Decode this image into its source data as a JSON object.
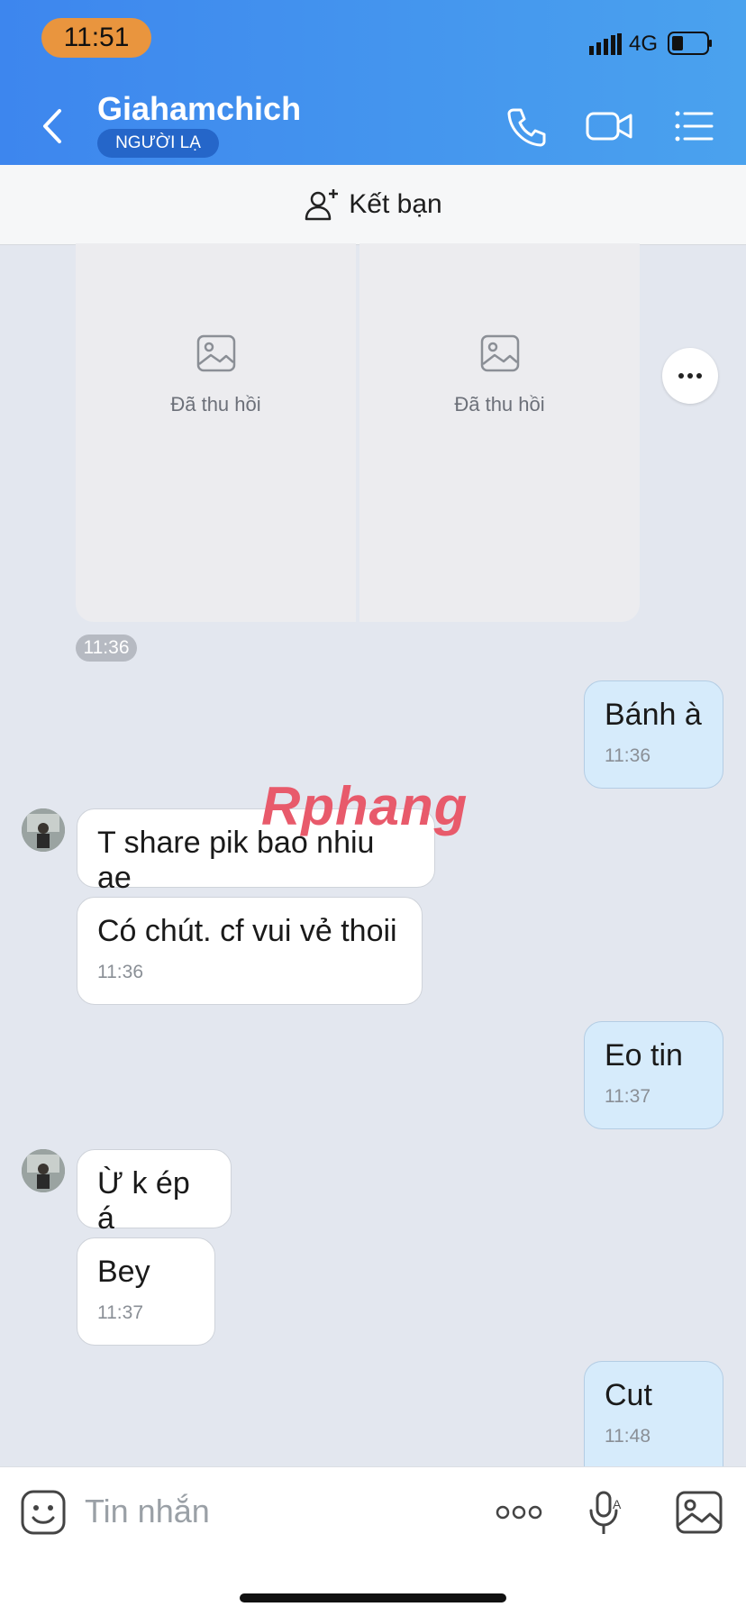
{
  "status_bar": {
    "time": "11:51",
    "network": "4G"
  },
  "header": {
    "title": "Giahamchich",
    "badge": "NGƯỜI LẠ"
  },
  "friend_bar": {
    "label": "Kết bạn"
  },
  "revoked_images": [
    {
      "label": "Đã thu hồi"
    },
    {
      "label": "Đã thu hồi"
    }
  ],
  "revoked_time": "11:36",
  "messages": [
    {
      "side": "out",
      "text": "Bánh à",
      "time": "11:36"
    },
    {
      "side": "in",
      "text": "T share pik bao nhiu ae",
      "time": ""
    },
    {
      "side": "in",
      "text": "Có chút. cf vui vẻ thoii",
      "time": "11:36"
    },
    {
      "side": "out",
      "text": "Eo tin",
      "time": "11:37"
    },
    {
      "side": "in",
      "text": "Ừ k ép á",
      "time": ""
    },
    {
      "side": "in",
      "text": "Bey",
      "time": "11:37"
    },
    {
      "side": "out",
      "text": "Cut",
      "time": "11:48"
    }
  ],
  "watermark": "Rphang",
  "composer": {
    "placeholder": "Tin nhắn"
  },
  "icons": [
    "back-icon",
    "phone-icon",
    "video-icon",
    "menu-icon",
    "add-friend-icon",
    "image-icon",
    "more-icon",
    "emoji-icon",
    "mic-icon",
    "gallery-icon"
  ],
  "colors": {
    "header_start": "#3d86ee",
    "header_end": "#4aa2ee",
    "time_pill": "#e9953e",
    "outgoing_bubble": "#d6ebfb"
  }
}
